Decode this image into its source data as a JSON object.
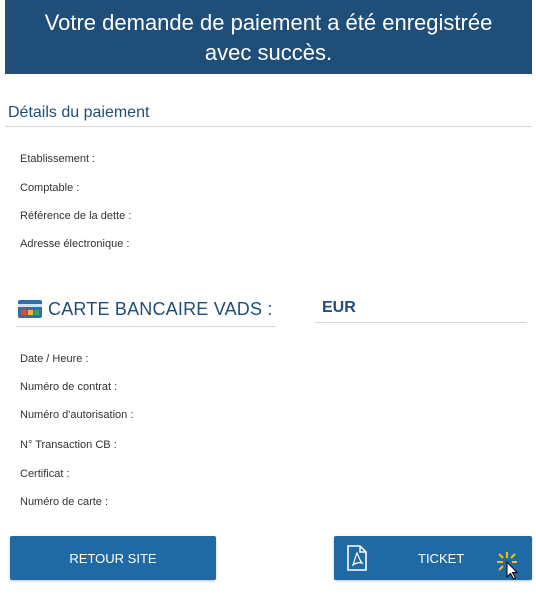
{
  "banner": {
    "line1": "Votre demande de paiement a été enregistrée",
    "line2": "avec succès."
  },
  "details": {
    "title": "Détails du paiement",
    "fields": [
      "Etablissement :",
      "Comptable :",
      "Référence de la dette :",
      "Adresse électronique :"
    ]
  },
  "payment": {
    "method": "CARTE BANCAIRE VADS :",
    "currency": "EUR",
    "fields": [
      "Date / Heure :",
      "Numéro de contrat :",
      "Numéro d'autorisation :",
      "N° Transaction CB :",
      "Certificat :",
      "Numéro de carte :"
    ]
  },
  "buttons": {
    "retour": "RETOUR SITE",
    "ticket": "TICKET"
  },
  "icons": {
    "card": "credit-card-icon",
    "pdf": "pdf-document-icon",
    "cursor": "click-cursor-icon"
  },
  "colors": {
    "banner": "#1f4e79",
    "button": "#1f6aa5",
    "accent": "#1f4e79"
  }
}
